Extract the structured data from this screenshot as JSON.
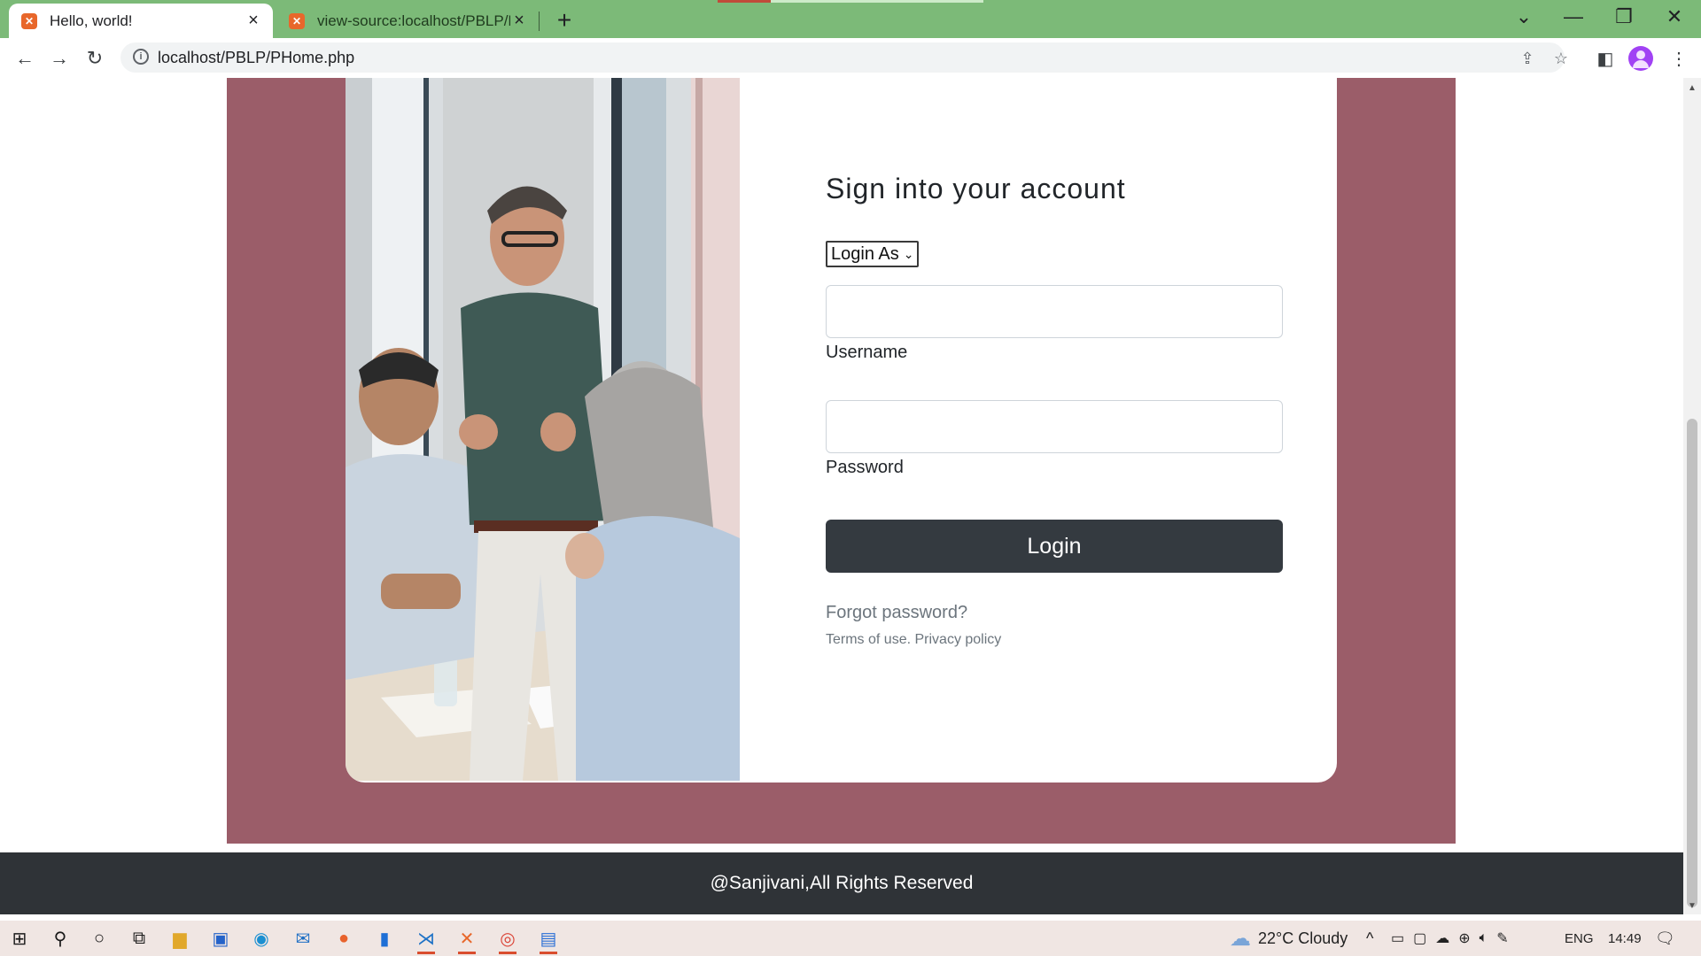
{
  "browser": {
    "tabs": [
      {
        "title": "Hello, world!",
        "active": true
      },
      {
        "title": "view-source:localhost/PBLP/PHo",
        "active": false
      }
    ],
    "url": "localhost/PBLP/PHome.php"
  },
  "page": {
    "form": {
      "title": "Sign into your account",
      "select_selected": "Login As",
      "username_label": "Username",
      "password_label": "Password",
      "login_button": "Login",
      "forgot_link": "Forgot password?",
      "terms_link": "Terms of use.",
      "privacy_link": "Privacy policy"
    },
    "footer_text": "@Sanjivani,All Rights Reserved"
  },
  "taskbar": {
    "weather": "22°C  Cloudy",
    "language": "ENG",
    "time": "14:49"
  },
  "colors": {
    "tab_bar": "#7cba78",
    "band": "#9b5d69",
    "login_button": "#343a40",
    "footer": "#2f3337"
  }
}
